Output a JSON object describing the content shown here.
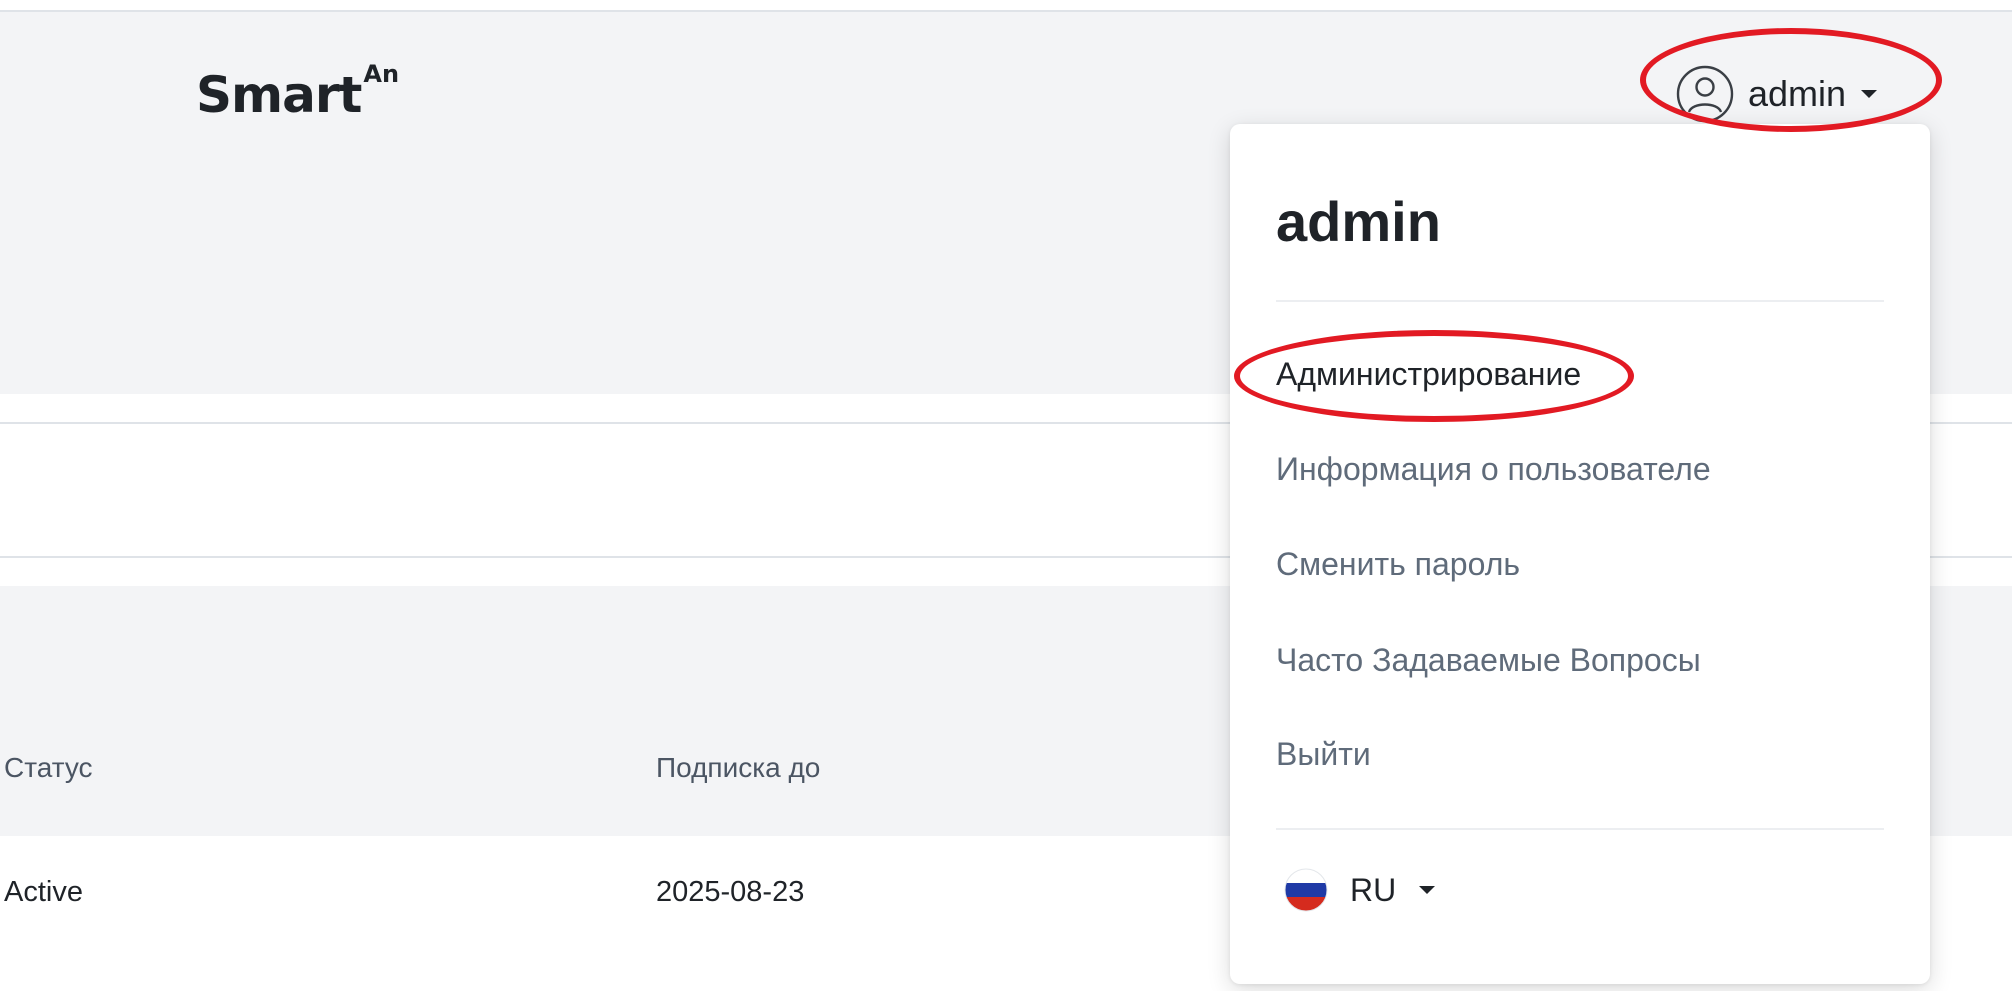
{
  "logo": {
    "main": "Smart",
    "superscript": "An"
  },
  "header": {
    "user_name": "admin",
    "user_icon": "user-circle-icon",
    "chevron_icon": "caret-down-icon"
  },
  "dropdown": {
    "title": "admin",
    "items": [
      {
        "label": "Администрирование"
      },
      {
        "label": "Информация о пользователе"
      },
      {
        "label": "Сменить пароль"
      },
      {
        "label": "Часто Задаваемые Вопросы"
      },
      {
        "label": "Выйти"
      }
    ],
    "language": {
      "code": "RU",
      "flag_icon": "russia-flag-icon",
      "chevron_icon": "caret-down-icon"
    }
  },
  "table": {
    "columns": [
      "Статус",
      "Подписка до"
    ],
    "rows": [
      [
        "Active",
        "2025-08-23"
      ]
    ]
  },
  "colors": {
    "annotation_red": "#e21a23",
    "band_gray": "#f3f4f6",
    "text_dark": "#1f2328",
    "text_muted": "#5f6b7a"
  }
}
